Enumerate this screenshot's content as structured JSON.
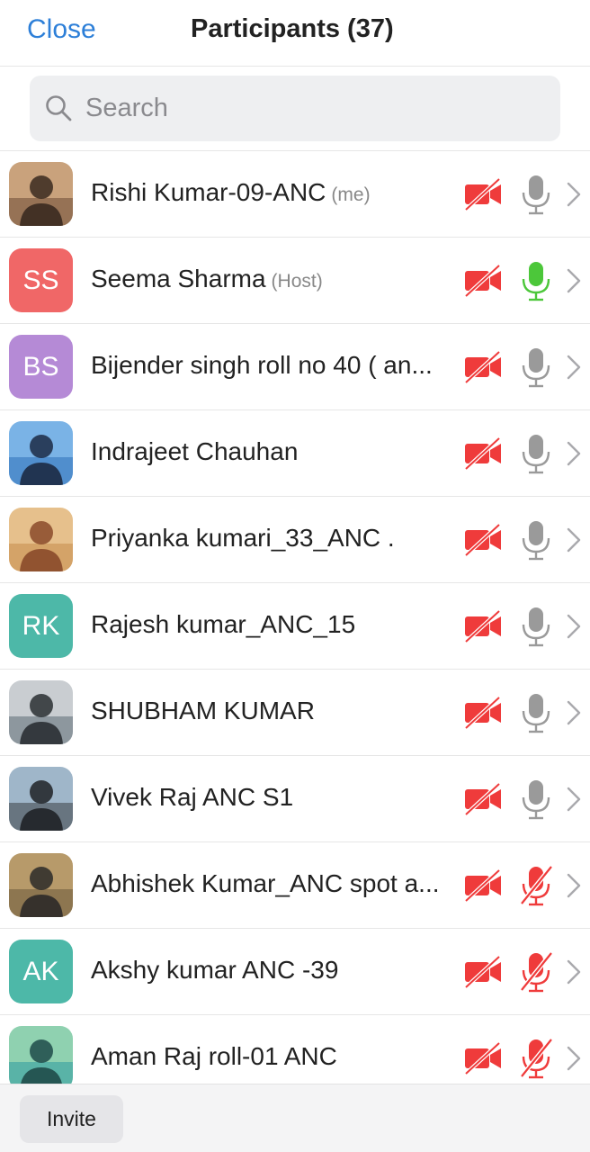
{
  "header": {
    "close_label": "Close",
    "title": "Participants (37)"
  },
  "search": {
    "placeholder": "Search",
    "value": ""
  },
  "participants": [
    {
      "name": "Rishi Kumar-09-ANC",
      "tag": "(me)",
      "avatar": "photo",
      "video": "off",
      "mic": "unmuted-idle"
    },
    {
      "name": "Seema Sharma",
      "tag": "(Host)",
      "avatar_initials": "SS",
      "avatar_color": "#f06767",
      "video": "off",
      "mic": "speaking"
    },
    {
      "name": "Bijender singh roll no 40 ( an...",
      "tag": "",
      "avatar_initials": "BS",
      "avatar_color": "#b58ad6",
      "video": "off",
      "mic": "unmuted-idle"
    },
    {
      "name": "Indrajeet Chauhan",
      "tag": "",
      "avatar": "photo",
      "video": "off",
      "mic": "unmuted-idle"
    },
    {
      "name": "Priyanka kumari_33_ANC .",
      "tag": "",
      "avatar": "photo",
      "video": "off",
      "mic": "unmuted-idle"
    },
    {
      "name": "Rajesh kumar_ANC_15",
      "tag": "",
      "avatar_initials": "RK",
      "avatar_color": "#4db8a8",
      "video": "off",
      "mic": "unmuted-idle"
    },
    {
      "name": "SHUBHAM KUMAR",
      "tag": "",
      "avatar": "photo",
      "video": "off",
      "mic": "unmuted-idle"
    },
    {
      "name": "Vivek Raj ANC S1",
      "tag": "",
      "avatar": "photo",
      "video": "off",
      "mic": "unmuted-idle"
    },
    {
      "name": "Abhishek Kumar_ANC spot a...",
      "tag": "",
      "avatar": "photo",
      "video": "off",
      "mic": "muted"
    },
    {
      "name": "Akshy kumar ANC -39",
      "tag": "",
      "avatar_initials": "AK",
      "avatar_color": "#4db8a8",
      "video": "off",
      "mic": "muted"
    },
    {
      "name": "Aman Raj roll-01 ANC",
      "tag": "",
      "avatar": "photo",
      "video": "off",
      "mic": "muted"
    }
  ],
  "footer": {
    "invite_label": "Invite"
  },
  "colors": {
    "accent": "#2d7fd8",
    "video_off": "#ef3b3b",
    "mic_idle": "#9a9a9a",
    "mic_speaking": "#4cc73a",
    "mic_muted": "#ef3b3b"
  }
}
